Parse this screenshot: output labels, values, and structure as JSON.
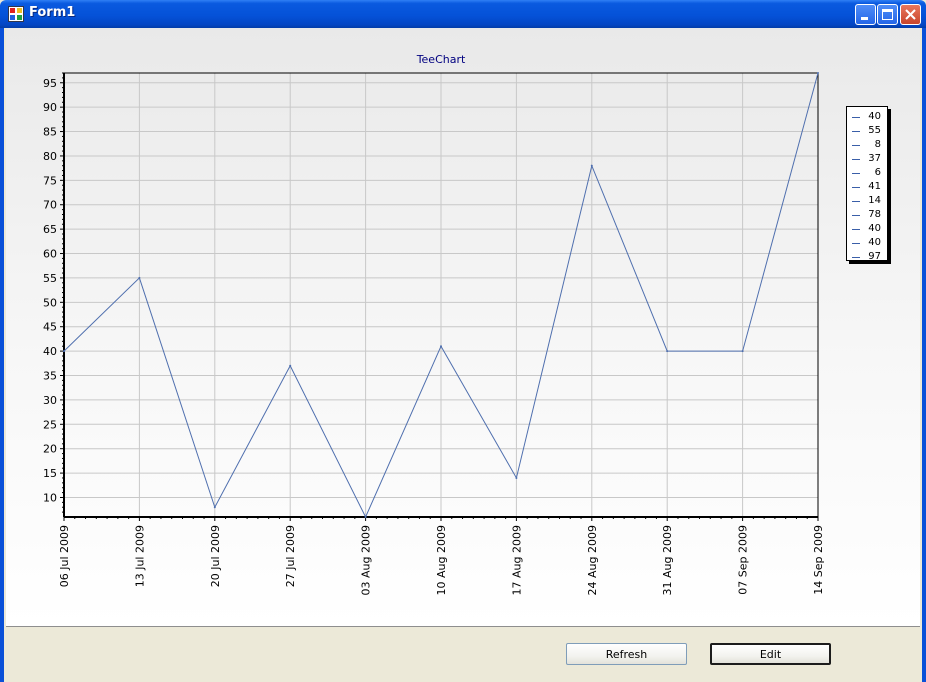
{
  "window": {
    "title": "Form1",
    "controls": {
      "minimize_icon": "minimize-icon",
      "maximize_icon": "maximize-icon",
      "close_icon": "close-icon"
    }
  },
  "buttons": {
    "refresh_label": "Refresh",
    "edit_label": "Edit"
  },
  "colors": {
    "series": "#4f6fae",
    "titlebar": "#0552d8",
    "chart_title": "#000080"
  },
  "chart_data": {
    "type": "line",
    "title": "TeeChart",
    "x": [
      "06 Jul 2009",
      "13 Jul 2009",
      "20 Jul 2009",
      "27 Jul 2009",
      "03 Aug 2009",
      "10 Aug 2009",
      "17 Aug 2009",
      "24 Aug 2009",
      "31 Aug 2009",
      "07 Sep 2009",
      "14 Sep 2009"
    ],
    "values": [
      40,
      55,
      8,
      37,
      6,
      41,
      14,
      78,
      40,
      40,
      97
    ],
    "ylim": [
      6,
      97
    ],
    "yticks": [
      10,
      15,
      20,
      25,
      30,
      35,
      40,
      45,
      50,
      55,
      60,
      65,
      70,
      75,
      80,
      85,
      90,
      95
    ],
    "grid": true,
    "legend": {
      "placement": "right",
      "entries": [
        "40",
        "55",
        "8",
        "37",
        "6",
        "41",
        "14",
        "78",
        "40",
        "40",
        "97"
      ]
    }
  }
}
